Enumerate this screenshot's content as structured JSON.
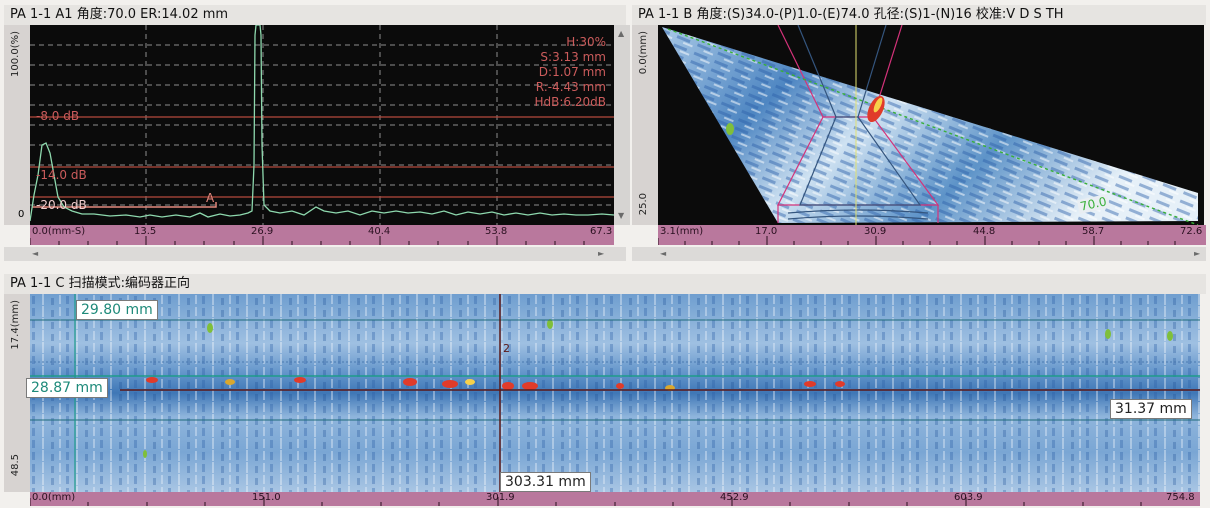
{
  "a_scan": {
    "title": "PA 1-1 A1 角度:70.0 ER:14.02 mm",
    "y_axis_label": "100.0(%)",
    "readouts": [
      "H:30%",
      "S:3.13 mm",
      "D:1.07 mm",
      "R:-4.43 mm",
      "HdB:6.20dB"
    ],
    "dac_labels": [
      "-8.0 dB",
      "-14.0 dB",
      "-20.0 dB"
    ],
    "gate_label": "A",
    "ruler_ticks": [
      "0.0(mm-S)",
      "13.5",
      "26.9",
      "40.4",
      "53.8",
      "67.3"
    ],
    "y_tick_bottom": "0",
    "scroll_up": "▲",
    "scroll_down": "▼",
    "scroll_left": "◄",
    "scroll_right": "►",
    "colors": {
      "background": "#0b0b0b",
      "trace": "#8ed9ae",
      "grid": "#8c8c8c",
      "dac": "#b5493c"
    }
  },
  "b_scan": {
    "title": "PA 1-1 B 角度:(S)34.0-(P)1.0-(E)74.0 孔径:(S)1-(N)16 校准:V D S TH",
    "y_axis_top": "0.0(mm)",
    "y_axis_bottom": "25.0",
    "ruler_ticks": [
      "3.1(mm)",
      "17.0",
      "30.9",
      "44.8",
      "58.7",
      "72.6"
    ],
    "angle_label": "70.0",
    "scroll_left": "◄",
    "scroll_right": "►",
    "colors": {
      "beam": "#d4327a",
      "beam_inner": "#34557e",
      "angle_line": "#38b038"
    }
  },
  "c_scan": {
    "title": "PA 1-1 C 扫描模式:编码器正向",
    "y_axis_top": "17.4(mm)",
    "y_axis_bottom": "48.5",
    "ruler_ticks": [
      "0.0(mm)",
      "151.0",
      "301.9",
      "452.9",
      "603.9",
      "754.8"
    ],
    "cursor_labels": {
      "top": "29.80 mm",
      "middle": "28.87 mm",
      "right": "31.37 mm",
      "bottom": "303.31 mm"
    },
    "cursor_index": "2",
    "colors": {
      "cursor": "#5a1818",
      "reference": "#1e9b8a",
      "ruler": "#b9789d"
    }
  }
}
